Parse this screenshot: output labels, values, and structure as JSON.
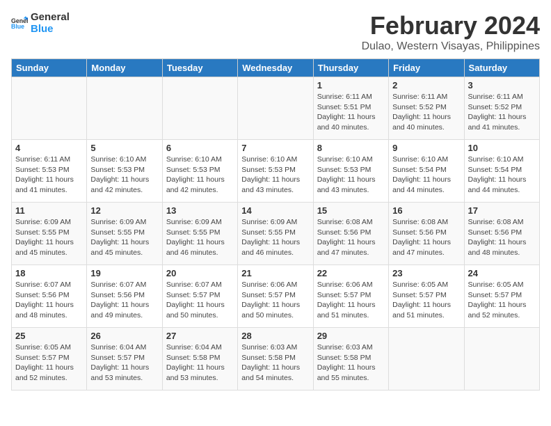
{
  "logo": {
    "line1": "General",
    "line2": "Blue"
  },
  "title": "February 2024",
  "subtitle": "Dulao, Western Visayas, Philippines",
  "headers": [
    "Sunday",
    "Monday",
    "Tuesday",
    "Wednesday",
    "Thursday",
    "Friday",
    "Saturday"
  ],
  "weeks": [
    [
      {
        "day": "",
        "info": ""
      },
      {
        "day": "",
        "info": ""
      },
      {
        "day": "",
        "info": ""
      },
      {
        "day": "",
        "info": ""
      },
      {
        "day": "1",
        "info": "Sunrise: 6:11 AM\nSunset: 5:51 PM\nDaylight: 11 hours\nand 40 minutes."
      },
      {
        "day": "2",
        "info": "Sunrise: 6:11 AM\nSunset: 5:52 PM\nDaylight: 11 hours\nand 40 minutes."
      },
      {
        "day": "3",
        "info": "Sunrise: 6:11 AM\nSunset: 5:52 PM\nDaylight: 11 hours\nand 41 minutes."
      }
    ],
    [
      {
        "day": "4",
        "info": "Sunrise: 6:11 AM\nSunset: 5:53 PM\nDaylight: 11 hours\nand 41 minutes."
      },
      {
        "day": "5",
        "info": "Sunrise: 6:10 AM\nSunset: 5:53 PM\nDaylight: 11 hours\nand 42 minutes."
      },
      {
        "day": "6",
        "info": "Sunrise: 6:10 AM\nSunset: 5:53 PM\nDaylight: 11 hours\nand 42 minutes."
      },
      {
        "day": "7",
        "info": "Sunrise: 6:10 AM\nSunset: 5:53 PM\nDaylight: 11 hours\nand 43 minutes."
      },
      {
        "day": "8",
        "info": "Sunrise: 6:10 AM\nSunset: 5:53 PM\nDaylight: 11 hours\nand 43 minutes."
      },
      {
        "day": "9",
        "info": "Sunrise: 6:10 AM\nSunset: 5:54 PM\nDaylight: 11 hours\nand 44 minutes."
      },
      {
        "day": "10",
        "info": "Sunrise: 6:10 AM\nSunset: 5:54 PM\nDaylight: 11 hours\nand 44 minutes."
      }
    ],
    [
      {
        "day": "11",
        "info": "Sunrise: 6:09 AM\nSunset: 5:55 PM\nDaylight: 11 hours\nand 45 minutes."
      },
      {
        "day": "12",
        "info": "Sunrise: 6:09 AM\nSunset: 5:55 PM\nDaylight: 11 hours\nand 45 minutes."
      },
      {
        "day": "13",
        "info": "Sunrise: 6:09 AM\nSunset: 5:55 PM\nDaylight: 11 hours\nand 46 minutes."
      },
      {
        "day": "14",
        "info": "Sunrise: 6:09 AM\nSunset: 5:55 PM\nDaylight: 11 hours\nand 46 minutes."
      },
      {
        "day": "15",
        "info": "Sunrise: 6:08 AM\nSunset: 5:56 PM\nDaylight: 11 hours\nand 47 minutes."
      },
      {
        "day": "16",
        "info": "Sunrise: 6:08 AM\nSunset: 5:56 PM\nDaylight: 11 hours\nand 47 minutes."
      },
      {
        "day": "17",
        "info": "Sunrise: 6:08 AM\nSunset: 5:56 PM\nDaylight: 11 hours\nand 48 minutes."
      }
    ],
    [
      {
        "day": "18",
        "info": "Sunrise: 6:07 AM\nSunset: 5:56 PM\nDaylight: 11 hours\nand 48 minutes."
      },
      {
        "day": "19",
        "info": "Sunrise: 6:07 AM\nSunset: 5:56 PM\nDaylight: 11 hours\nand 49 minutes."
      },
      {
        "day": "20",
        "info": "Sunrise: 6:07 AM\nSunset: 5:57 PM\nDaylight: 11 hours\nand 50 minutes."
      },
      {
        "day": "21",
        "info": "Sunrise: 6:06 AM\nSunset: 5:57 PM\nDaylight: 11 hours\nand 50 minutes."
      },
      {
        "day": "22",
        "info": "Sunrise: 6:06 AM\nSunset: 5:57 PM\nDaylight: 11 hours\nand 51 minutes."
      },
      {
        "day": "23",
        "info": "Sunrise: 6:05 AM\nSunset: 5:57 PM\nDaylight: 11 hours\nand 51 minutes."
      },
      {
        "day": "24",
        "info": "Sunrise: 6:05 AM\nSunset: 5:57 PM\nDaylight: 11 hours\nand 52 minutes."
      }
    ],
    [
      {
        "day": "25",
        "info": "Sunrise: 6:05 AM\nSunset: 5:57 PM\nDaylight: 11 hours\nand 52 minutes."
      },
      {
        "day": "26",
        "info": "Sunrise: 6:04 AM\nSunset: 5:57 PM\nDaylight: 11 hours\nand 53 minutes."
      },
      {
        "day": "27",
        "info": "Sunrise: 6:04 AM\nSunset: 5:58 PM\nDaylight: 11 hours\nand 53 minutes."
      },
      {
        "day": "28",
        "info": "Sunrise: 6:03 AM\nSunset: 5:58 PM\nDaylight: 11 hours\nand 54 minutes."
      },
      {
        "day": "29",
        "info": "Sunrise: 6:03 AM\nSunset: 5:58 PM\nDaylight: 11 hours\nand 55 minutes."
      },
      {
        "day": "",
        "info": ""
      },
      {
        "day": "",
        "info": ""
      }
    ]
  ]
}
